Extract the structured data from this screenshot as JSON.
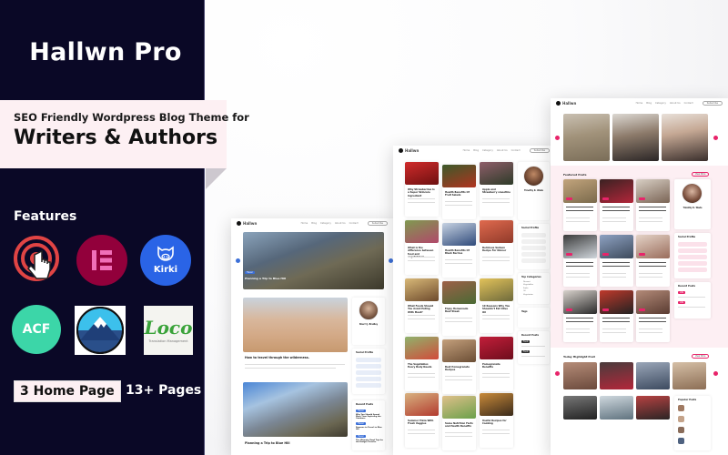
{
  "banner": {
    "title": "Hallwn Pro",
    "subtitle": "SEO Friendly Wordpress Blog Theme for",
    "headline": "Writers & Authors",
    "features_title": "Features",
    "features": [
      {
        "name": "touch-icon",
        "label": ""
      },
      {
        "name": "elementor-icon",
        "label": ""
      },
      {
        "name": "kirki-icon",
        "label": "Kirki"
      },
      {
        "name": "acf-icon",
        "label": "ACF"
      },
      {
        "name": "mountain-icon",
        "label": ""
      },
      {
        "name": "loco-icon",
        "label": "Loco",
        "sublabel": "Translation Management"
      }
    ],
    "home_pages": "3 Home Page",
    "pages": "13+ Pages"
  },
  "colors": {
    "panel_bg": "#0a0826",
    "ribbon_bg": "#fdf0f3",
    "accent_blue": "#3b6fd8",
    "accent_pink": "#e8246a",
    "accent_dark": "#222222"
  },
  "mockups": {
    "common": {
      "logo": "Hallwn",
      "menu": [
        "Home",
        "Blog",
        "Category",
        "About Us",
        "Contact"
      ],
      "subscribe": "Subscribe"
    },
    "travel": {
      "hero_title": "Planning a Trip to Blue Hill",
      "posts": [
        {
          "title": "How to travel through the wilderness.",
          "tag": "Travel"
        },
        {
          "title": "Planning a Trip to Blue Hill",
          "tag": "Travel"
        }
      ],
      "author_name": "Sherri J. Bradley",
      "social_title": "Social Profile",
      "recent_title": "Recent Posts",
      "recent": [
        "Why You Should Spend More Time Exploring the Outdoors",
        "Reasons to Travel to Blue Hill",
        "The Ultimate Road Trip for the Budget Traveler"
      ]
    },
    "food": {
      "posts": [
        "Why Strawberries Is a Super Skincare Ingredient",
        "Health Benefits Of Fruit Salads",
        "Apple and Strawberry smoothie",
        "What is the difference between food and vegetables?",
        "Health Benefits Of Black Berries",
        "Delicious Salmon Recipe For Dinner",
        "What Foods Should You Avoid Eating With Meat?",
        "Enjoy Homemade Beef Steak",
        "10 Reasons Why You Shouldn't Eat Olive Oil",
        "The Vegetables Every Body Needs",
        "Best Pomegranate Recipes",
        "Pomegranate Benefits",
        "Summer Pizza With Fresh Veggies",
        "Some Nutrition Facts and Health Benefits",
        "Useful Recipes for Cooking"
      ],
      "author_name": "Timothy K. Wade",
      "social_title": "Social Profile",
      "categories_title": "Top Categories",
      "categories": [
        "Dessert",
        "Vegetables",
        "Fruits",
        "Oil",
        "Vegetarian"
      ],
      "tags_title": "Tags",
      "recent_title": "Recent Posts"
    },
    "lifestyle": {
      "featured_title": "Featured Posts",
      "view_more": "View More",
      "highlight_title": "Today Highlight Post",
      "popular_title": "Popular Posts",
      "author_name": "Timothy K. Wade",
      "social_title": "Social Profile",
      "recent_title": "Recent Posts"
    }
  }
}
